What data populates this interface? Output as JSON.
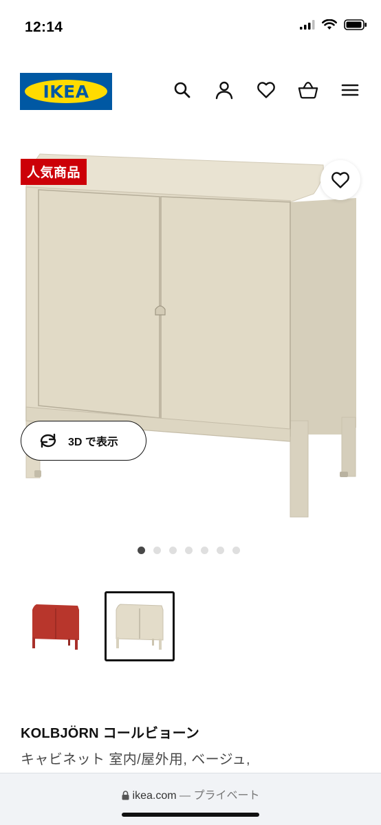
{
  "status_bar": {
    "time": "12:14"
  },
  "header": {
    "logo_text": "IKEA"
  },
  "product": {
    "badge": "人気商品",
    "view_3d_label": "3D で表示",
    "carousel": {
      "total": 7,
      "active_index": 0
    },
    "variants": [
      {
        "color_name": "red",
        "color": "#b8362c",
        "selected": false
      },
      {
        "color_name": "beige",
        "color": "#e3dcc9",
        "selected": true
      }
    ],
    "name": "KOLBJÖRN コールビョーン",
    "description": "キャビネット 室内/屋外用, ベージュ,"
  },
  "browser": {
    "domain": "ikea.com",
    "separator": "—",
    "mode": "プライベート"
  },
  "colors": {
    "ikea_blue": "#0058a3",
    "ikea_yellow": "#ffdb00",
    "badge_red": "#cc0008",
    "cabinet_beige": "#e3dcc9"
  }
}
